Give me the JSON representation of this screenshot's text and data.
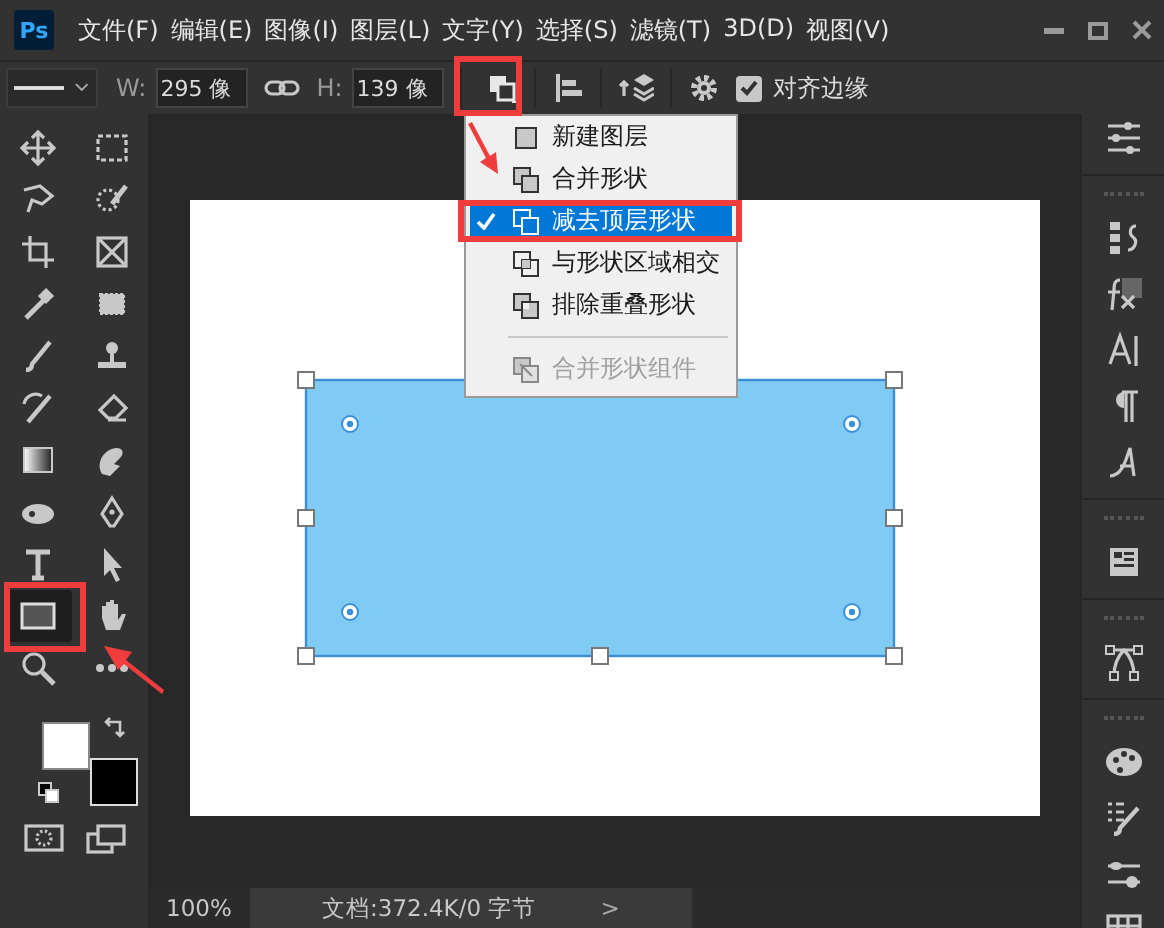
{
  "app": {
    "logo": "Ps"
  },
  "menu": [
    {
      "label": "文件(F)"
    },
    {
      "label": "编辑(E)"
    },
    {
      "label": "图像(I)"
    },
    {
      "label": "图层(L)"
    },
    {
      "label": "文字(Y)"
    },
    {
      "label": "选择(S)"
    },
    {
      "label": "滤镜(T)"
    },
    {
      "label": "3D(D)"
    },
    {
      "label": "视图(V)"
    }
  ],
  "options": {
    "width_label": "W:",
    "width_value": "295 像",
    "height_label": "H:",
    "height_value": "139 像",
    "align_edges": {
      "label": "对齐边缘",
      "checked": true
    }
  },
  "tools": [
    {
      "kind": "move",
      "selected": false
    },
    {
      "kind": "marquee",
      "selected": false
    },
    {
      "kind": "lasso",
      "selected": false
    },
    {
      "kind": "quick_select",
      "selected": false
    },
    {
      "kind": "crop",
      "selected": false
    },
    {
      "kind": "frame",
      "selected": false
    },
    {
      "kind": "eyedropper",
      "selected": false
    },
    {
      "kind": "patch",
      "selected": false
    },
    {
      "kind": "brush",
      "selected": false
    },
    {
      "kind": "stamp",
      "selected": false
    },
    {
      "kind": "history_brush",
      "selected": false
    },
    {
      "kind": "eraser",
      "selected": false
    },
    {
      "kind": "gradient",
      "selected": false
    },
    {
      "kind": "smudge",
      "selected": false
    },
    {
      "kind": "sponge",
      "selected": false
    },
    {
      "kind": "pen",
      "selected": false
    },
    {
      "kind": "type",
      "selected": false
    },
    {
      "kind": "path_select",
      "selected": false
    },
    {
      "kind": "rectangle",
      "selected": true
    },
    {
      "kind": "hand",
      "selected": false
    },
    {
      "kind": "zoom",
      "selected": false
    },
    {
      "kind": "more",
      "selected": false
    }
  ],
  "color_swatches": [
    {
      "kind": "foreground",
      "color": "#ffffff"
    },
    {
      "kind": "background",
      "color": "#000000"
    }
  ],
  "shape_menu": {
    "items": [
      {
        "kind": "new_layer",
        "label": "新建图层",
        "selected": false,
        "disabled": false
      },
      {
        "kind": "combine",
        "label": "合并形状",
        "selected": false,
        "disabled": false
      },
      {
        "kind": "subtract",
        "label": "减去顶层形状",
        "selected": true,
        "disabled": false
      },
      {
        "kind": "intersect",
        "label": "与形状区域相交",
        "selected": false,
        "disabled": false
      },
      {
        "kind": "exclude",
        "label": "排除重叠形状",
        "selected": false,
        "disabled": false
      },
      {
        "kind": "separator"
      },
      {
        "kind": "merge",
        "label": "合并形状组件",
        "selected": false,
        "disabled": true
      }
    ]
  },
  "status_bar": {
    "zoom": "100%",
    "doc_info": "文档:372.4K/0 字节",
    "arrow": ">"
  }
}
